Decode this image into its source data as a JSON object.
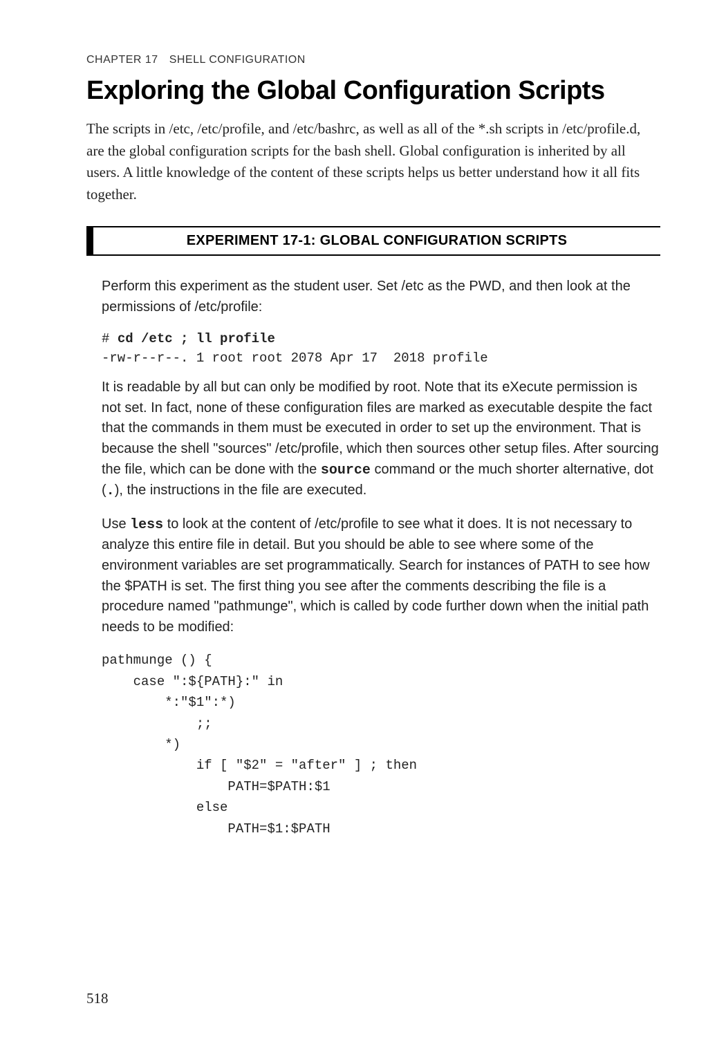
{
  "chapter": {
    "num": "CHAPTER 17",
    "title": "SHELL CONFIGURATION"
  },
  "heading": "Exploring the Global Configuration Scripts",
  "intro": "The scripts in /etc, /etc/profile, and /etc/bashrc, as well as all of the *.sh scripts in /etc/profile.d, are the global configuration scripts for the bash shell. Global configuration is inherited by all users. A little knowledge of the content of these scripts helps us better understand how it all fits together.",
  "experiment_title": "EXPERIMENT 17-1: GLOBAL CONFIGURATION SCRIPTS",
  "p1": "Perform this experiment as the student user. Set /etc as the PWD, and then look at the permissions of /etc/profile:",
  "cmd1_prompt": "# ",
  "cmd1": "cd /etc ; ll profile",
  "cmd1_output": "-rw-r--r--. 1 root root 2078 Apr 17  2018 profile",
  "p2a": "It is readable by all but can only be modified by root. Note that its eXecute permission is not set. In fact, none of these configuration files are marked as executable despite the fact that the commands in them must be executed in order to set up the environment. That is because the shell \"sources\" /etc/profile, which then sources other setup files. After sourcing the file, which can be done with the ",
  "p2_src": "source",
  "p2b": " command or the much shorter alternative, dot (",
  "p2_dot": ".",
  "p2c": "), the instructions in the file are executed.",
  "p3a": "Use ",
  "p3_less": "less",
  "p3b": " to look at the content of /etc/profile to see what it does. It is not necessary to analyze this entire file in detail. But you should be able to see where some of the environment variables are set programmatically. Search for instances of PATH to see how the $PATH is set. The first thing you see after the comments describing the file is a procedure named \"pathmunge\", which is called by code further down when the initial path needs to be modified:",
  "code2": "pathmunge () {\n    case \":${PATH}:\" in\n        *:\"$1\":*)\n            ;;\n        *)\n            if [ \"$2\" = \"after\" ] ; then\n                PATH=$PATH:$1\n            else\n                PATH=$1:$PATH",
  "page_number": "518"
}
